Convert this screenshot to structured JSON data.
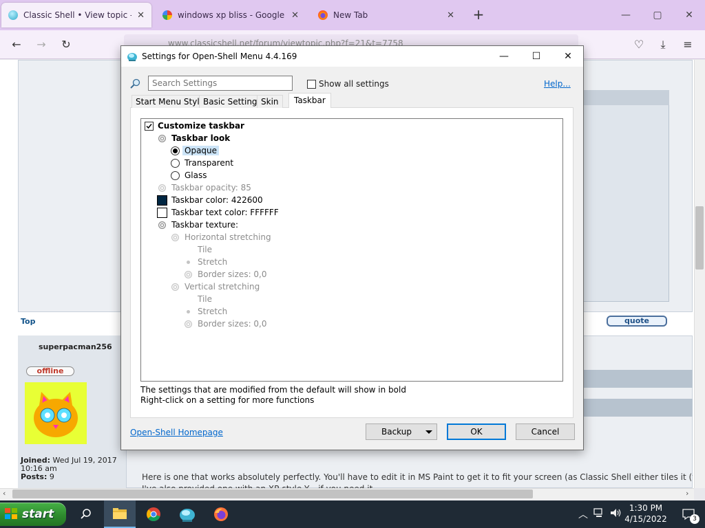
{
  "browser": {
    "tabs": [
      {
        "title": "Classic Shell • View topic - Windows",
        "close": "✕"
      },
      {
        "title": "windows xp bliss - Google Search",
        "close": "✕"
      },
      {
        "title": "New Tab",
        "close": "✕"
      }
    ],
    "new_tab": "+",
    "window_controls": {
      "minimize": "—",
      "maximize": "▢",
      "close": "✕"
    },
    "url": "www.classicshell.net/forum/viewtopic.php?f=21&t=7758"
  },
  "page": {
    "top_link": "Top",
    "quote_button": "quote",
    "author": "superpacman256",
    "status_badge": "offline",
    "joined_label": "Joined:",
    "joined_value": "Wed Jul 19, 2017 10:16 am",
    "posts_label": "Posts:",
    "posts_value": "9",
    "post_text": "Here is one that works absolutely perfectly. You'll have to edit it in MS Paint to get it to fit your screen (as Classic Shell either tiles it (you",
    "post_text_line2": "I've also provided one with an XP-style Y... if you need it"
  },
  "dialog": {
    "title": "Settings for Open-Shell Menu 4.4.169",
    "controls": {
      "minimize": "—",
      "maximize": "☐",
      "close": "✕"
    },
    "search_placeholder": "Search Settings",
    "show_all_label": "Show all settings",
    "help_link": "Help...",
    "tabs": [
      "Start Menu Style",
      "Basic Settings",
      "Skin",
      "Taskbar"
    ],
    "active_tab": "Taskbar",
    "tree": {
      "customize_taskbar": "Customize taskbar",
      "taskbar_look": "Taskbar look",
      "opaque": "Opaque",
      "transparent": "Transparent",
      "glass": "Glass",
      "taskbar_opacity": "Taskbar opacity: 85",
      "taskbar_color": "Taskbar color: 422600",
      "taskbar_text_color": "Taskbar text color: FFFFFF",
      "taskbar_texture": "Taskbar texture:",
      "horizontal_stretching": "Horizontal stretching",
      "h_tile": "Tile",
      "h_stretch": "Stretch",
      "h_border": "Border sizes: 0,0",
      "vertical_stretching": "Vertical stretching",
      "v_tile": "Tile",
      "v_stretch": "Stretch",
      "v_border": "Border sizes: 0,0"
    },
    "note_line1": "The settings that are modified from the default will show in bold",
    "note_line2": "Right-click on a setting for more functions",
    "homepage_link": "Open-Shell Homepage",
    "backup_button": "Backup",
    "ok_button": "OK",
    "cancel_button": "Cancel"
  },
  "taskbar": {
    "start_label": "start",
    "clock_time": "1:30 PM",
    "clock_date": "4/15/2022",
    "notification_count": "3"
  },
  "colors": {
    "taskbar_color_swatch": "#002642",
    "taskbar_text_swatch": "#FFFFFF",
    "accent": "#0078d7",
    "browser_tabbar": "#e0c8f0"
  }
}
